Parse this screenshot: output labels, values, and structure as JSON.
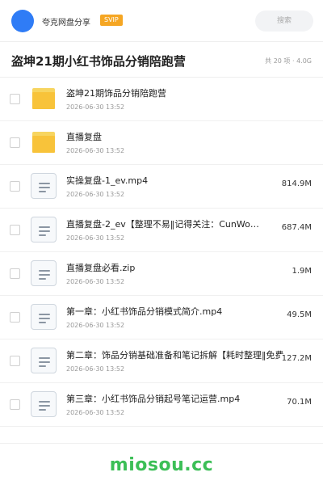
{
  "header": {
    "username": "夸克网盘分享",
    "badge": "SVIP",
    "search_placeholder": "搜索"
  },
  "share": {
    "title": "盗坤21期小红书饰品分销陪跑营",
    "meta": "共 20 项 · 4.0G"
  },
  "files": [
    {
      "type": "folder",
      "icon": "folder-icon",
      "name": "盗坤21期饰品分销陪跑营",
      "date": "2026-06-30 13:52",
      "size": ""
    },
    {
      "type": "folder",
      "icon": "folder-icon",
      "name": "直播复盘",
      "date": "2026-06-30 13:52",
      "size": ""
    },
    {
      "type": "file",
      "icon": "file-icon",
      "name": "实操复盘-1_ev.mp4",
      "date": "2026-06-30 13:52",
      "size": "814.9M"
    },
    {
      "type": "file",
      "icon": "file-icon",
      "name": "直播复盘-2_ev【整理不易‖记得关注：CunWo…",
      "date": "2026-06-30 13:52",
      "size": "687.4M"
    },
    {
      "type": "file",
      "icon": "file-icon",
      "name": "直播复盘必看.zip",
      "date": "2026-06-30 13:52",
      "size": "1.9M"
    },
    {
      "type": "file",
      "icon": "file-icon",
      "name": "第一章：小红书饰品分销模式简介.mp4",
      "date": "2026-06-30 13:52",
      "size": "49.5M"
    },
    {
      "type": "file",
      "icon": "file-icon",
      "name": "第二章：饰品分销基础准备和笔记拆解【耗时整理‖免费",
      "date": "2026-06-30 13:52",
      "size": "127.2M"
    },
    {
      "type": "file",
      "icon": "file-icon",
      "name": "第三章：小红书饰品分销起号笔记运营.mp4",
      "date": "2026-06-30 13:52",
      "size": "70.1M"
    }
  ],
  "watermark": "miosou.cc",
  "colors": {
    "avatar": "#2f7cf6",
    "svip_badge": "#f5a623",
    "folder": "#f8c33a",
    "watermark": "#3cbf57"
  }
}
